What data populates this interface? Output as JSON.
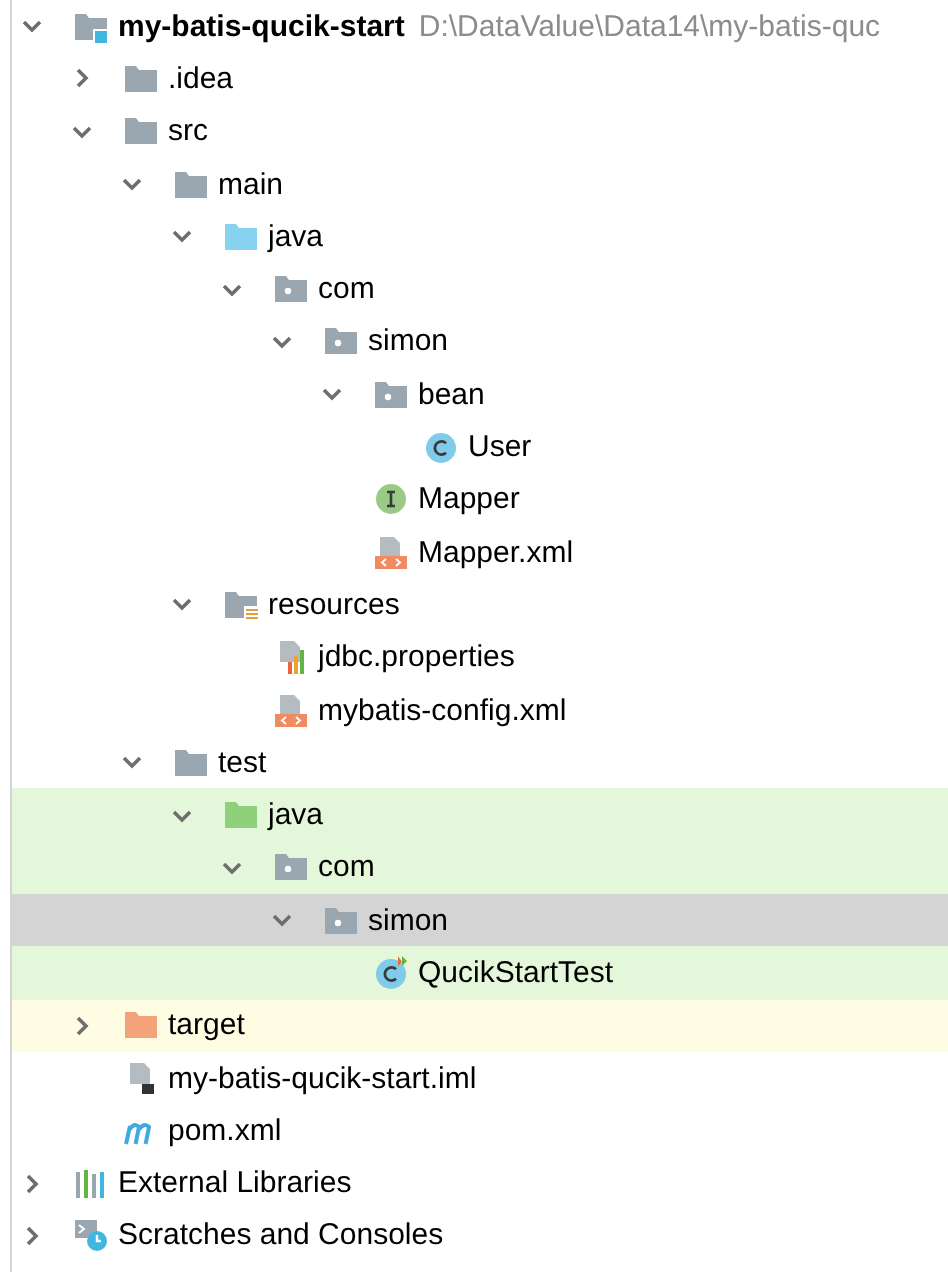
{
  "project_tree": [
    {
      "name": "my-batis-qucik-start",
      "path": "D:\\DataValue\\Data14\\my-batis-quc",
      "kind": "module",
      "expanded": true,
      "selected": false,
      "test_source": false,
      "excluded": false,
      "children": [
        {
          "name": ".idea",
          "kind": "folder",
          "expanded": false,
          "selected": false,
          "test_source": false,
          "excluded": false
        },
        {
          "name": "src",
          "kind": "folder",
          "expanded": true,
          "selected": false,
          "test_source": false,
          "excluded": false,
          "children": [
            {
              "name": "main",
              "kind": "folder",
              "expanded": true,
              "selected": false,
              "test_source": false,
              "excluded": false,
              "children": [
                {
                  "name": "java",
                  "kind": "source",
                  "expanded": true,
                  "selected": false,
                  "test_source": false,
                  "excluded": false,
                  "children": [
                    {
                      "name": "com",
                      "kind": "package",
                      "expanded": true,
                      "selected": false,
                      "test_source": false,
                      "excluded": false,
                      "children": [
                        {
                          "name": "simon",
                          "kind": "package",
                          "expanded": true,
                          "selected": false,
                          "test_source": false,
                          "excluded": false,
                          "children": [
                            {
                              "name": "bean",
                              "kind": "package",
                              "expanded": true,
                              "selected": false,
                              "test_source": false,
                              "excluded": false,
                              "children": [
                                {
                                  "name": "User",
                                  "kind": "class",
                                  "selected": false,
                                  "test_source": false,
                                  "excluded": false
                                }
                              ]
                            },
                            {
                              "name": "Mapper",
                              "kind": "interface",
                              "selected": false,
                              "test_source": false,
                              "excluded": false
                            },
                            {
                              "name": "Mapper.xml",
                              "kind": "xml",
                              "selected": false,
                              "test_source": false,
                              "excluded": false
                            }
                          ]
                        }
                      ]
                    }
                  ]
                },
                {
                  "name": "resources",
                  "kind": "resources",
                  "expanded": true,
                  "selected": false,
                  "test_source": false,
                  "excluded": false,
                  "children": [
                    {
                      "name": "jdbc.properties",
                      "kind": "properties",
                      "selected": false,
                      "test_source": false,
                      "excluded": false
                    },
                    {
                      "name": "mybatis-config.xml",
                      "kind": "xml",
                      "selected": false,
                      "test_source": false,
                      "excluded": false
                    }
                  ]
                }
              ]
            },
            {
              "name": "test",
              "kind": "folder",
              "expanded": true,
              "selected": false,
              "test_source": false,
              "excluded": false,
              "children": [
                {
                  "name": "java",
                  "kind": "test-source",
                  "expanded": true,
                  "selected": false,
                  "test_source": true,
                  "excluded": false,
                  "children": [
                    {
                      "name": "com",
                      "kind": "package",
                      "expanded": true,
                      "selected": false,
                      "test_source": true,
                      "excluded": false,
                      "children": [
                        {
                          "name": "simon",
                          "kind": "package",
                          "expanded": true,
                          "selected": true,
                          "test_source": true,
                          "excluded": false,
                          "children": [
                            {
                              "name": "QucikStartTest",
                              "kind": "test-class",
                              "selected": false,
                              "test_source": true,
                              "excluded": false
                            }
                          ]
                        }
                      ]
                    }
                  ]
                }
              ]
            }
          ]
        },
        {
          "name": "target",
          "kind": "excluded",
          "expanded": false,
          "selected": false,
          "test_source": false,
          "excluded": true
        },
        {
          "name": "my-batis-qucik-start.iml",
          "kind": "iml",
          "selected": false,
          "test_source": false,
          "excluded": false
        },
        {
          "name": "pom.xml",
          "kind": "maven",
          "selected": false,
          "test_source": false,
          "excluded": false
        }
      ]
    },
    {
      "name": "External Libraries",
      "kind": "libraries",
      "expanded": false,
      "selected": false,
      "test_source": false,
      "excluded": false
    },
    {
      "name": "Scratches and Consoles",
      "kind": "scratches",
      "expanded": false,
      "selected": false,
      "test_source": false,
      "excluded": false
    }
  ]
}
